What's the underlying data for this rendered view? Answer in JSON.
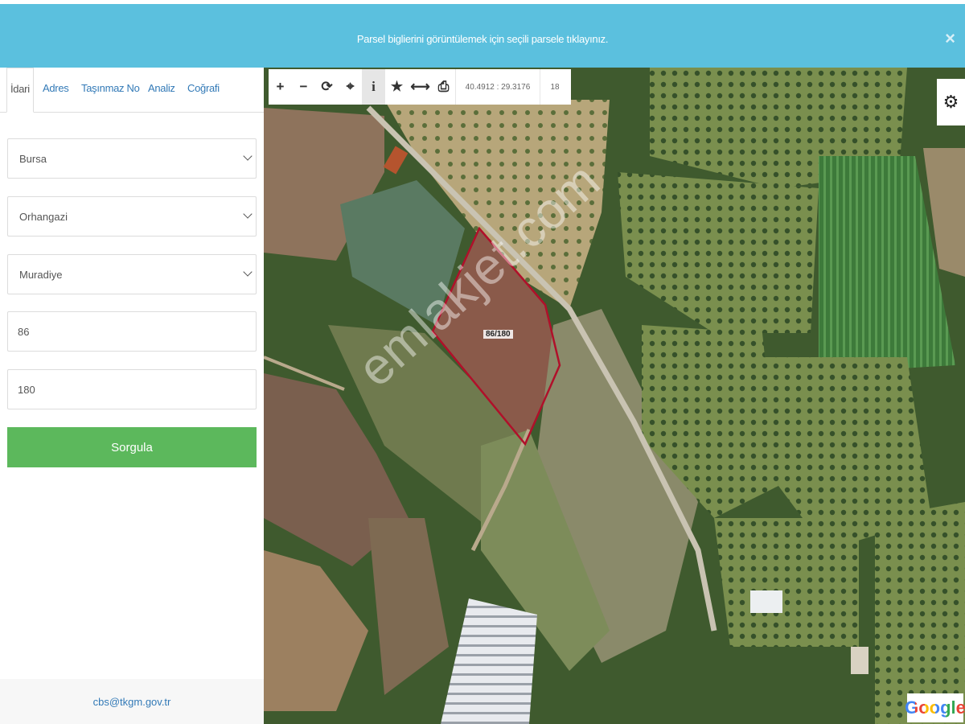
{
  "banner": {
    "message": "Parsel biglierini görüntülemek için seçili parsele tıklayınız.",
    "close": "×"
  },
  "tabs": [
    "İdari",
    "Adres",
    "Taşınmaz No",
    "Analiz",
    "Coğrafi"
  ],
  "form": {
    "province": "Bursa",
    "district": "Orhangazi",
    "neighborhood": "Muradiye",
    "block": "86",
    "parcel": "180",
    "submit": "Sorgula"
  },
  "footer": {
    "email": "cbs@tkgm.gov.tr"
  },
  "toolbar": {
    "icons": [
      "zoom-in-icon",
      "zoom-out-icon",
      "refresh-icon",
      "locate-icon",
      "info-icon",
      "star-icon",
      "measure-icon",
      "print-icon"
    ],
    "glyphs": [
      "+",
      "−",
      "⟳",
      "⌖",
      "i",
      "★",
      "⟷",
      "⎙"
    ],
    "coordinates": "40.4912 : 29.3176",
    "zoom": "18"
  },
  "map": {
    "parcel_label": "86/180",
    "watermark": "emlakjet.com",
    "attribution": "Google"
  },
  "colors": {
    "banner": "#5bc0de",
    "submit": "#5cb85c",
    "parcel_outline": "#b0102a",
    "link": "#337ab7"
  }
}
